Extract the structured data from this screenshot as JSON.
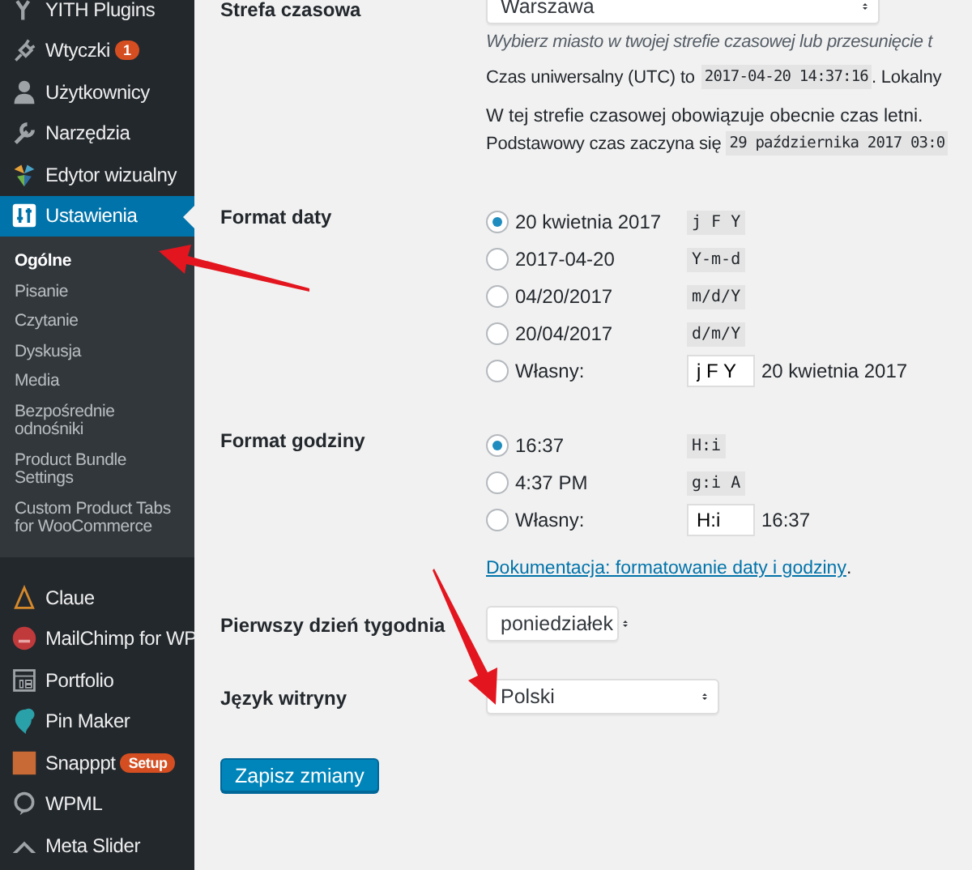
{
  "sidebar": {
    "menu_items": [
      {
        "label": "YITH Plugins",
        "selected": false
      },
      {
        "label": "Wtyczki",
        "badge": "1",
        "selected": false
      },
      {
        "label": "Użytkownicy",
        "selected": false
      },
      {
        "label": "Narzędzia",
        "selected": false
      },
      {
        "label": "Edytor wizualny",
        "selected": false
      },
      {
        "label": "Ustawienia",
        "selected": true,
        "children": [
          {
            "label": "Ogólne",
            "selected": true
          },
          {
            "label": "Pisanie",
            "selected": false
          },
          {
            "label": "Czytanie",
            "selected": false
          },
          {
            "label": "Dyskusja",
            "selected": false
          },
          {
            "label": "Media",
            "selected": false
          },
          {
            "label": "Bezpośrednie odnośniki",
            "selected": false
          },
          {
            "label": "Product Bundle Settings",
            "selected": false
          },
          {
            "label": "Custom Product Tabs for WooCommerce",
            "selected": false
          }
        ]
      },
      {
        "label": "Claue",
        "selected": false
      },
      {
        "label": "MailChimp for WP",
        "selected": false
      },
      {
        "label": "Portfolio",
        "selected": false
      },
      {
        "label": "Pin Maker",
        "selected": false
      },
      {
        "label": "Snapppt",
        "badge": "Setup",
        "selected": false
      },
      {
        "label": "WPML",
        "selected": false
      },
      {
        "label": "Meta Slider",
        "selected": false
      }
    ]
  },
  "settings": {
    "timezone": {
      "label": "Strefa czasowa",
      "value": "Warszawa",
      "description": "Wybierz miasto w twojej strefie czasowej lub przesunięcie t",
      "utc_label": "Czas uniwersalny (UTC) to",
      "utc_time": "2017-04-20 14:37:16",
      "local_label": ". Lokalny",
      "dst_note": "W tej strefie czasowej obowiązuje obecnie czas letni.",
      "standard_label": "Podstawowy czas zaczyna się",
      "standard_time": "29 października 2017 03:0"
    },
    "date_format": {
      "label": "Format daty",
      "options": [
        {
          "kind": "preset",
          "label": "20 kwietnia 2017",
          "format": "j F Y",
          "selected": true
        },
        {
          "kind": "preset",
          "label": "2017-04-20",
          "format": "Y-m-d",
          "selected": false
        },
        {
          "kind": "preset",
          "label": "04/20/2017",
          "format": "m/d/Y",
          "selected": false
        },
        {
          "kind": "preset",
          "label": "20/04/2017",
          "format": "d/m/Y",
          "selected": false
        },
        {
          "kind": "custom",
          "label": "Własny:",
          "format": "j F Y",
          "preview": "20 kwietnia 2017",
          "selected": false
        }
      ]
    },
    "time_format": {
      "label": "Format godziny",
      "options": [
        {
          "kind": "preset",
          "label": "16:37",
          "format": "H:i",
          "selected": true
        },
        {
          "kind": "preset",
          "label": "4:37 PM",
          "format": "g:i A",
          "selected": false
        },
        {
          "kind": "custom",
          "label": "Własny:",
          "format": "H:i",
          "preview": "16:37",
          "selected": false
        }
      ],
      "doc_link": "Dokumentacja: formatowanie daty i godziny",
      "doc_suffix": "."
    },
    "week_start": {
      "label": "Pierwszy dzień tygodnia",
      "value": "poniedziałek"
    },
    "language": {
      "label": "Język witryny",
      "value": "Polski"
    },
    "save_button": "Zapisz zmiany"
  }
}
